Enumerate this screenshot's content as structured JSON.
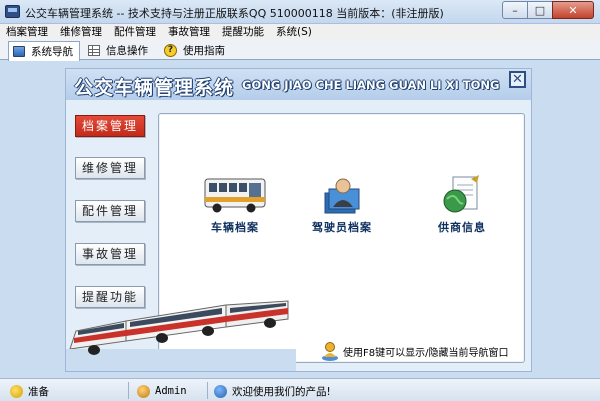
{
  "window": {
    "title": "公交车辆管理系统 -- 技术支持与注册正版联系QQ 510000118    当前版本：(非注册版)",
    "minimize": "–",
    "maximize": "□",
    "close": "✕"
  },
  "menu": [
    "档案管理",
    "维修管理",
    "配件管理",
    "事故管理",
    "提醒功能",
    "系统(S)"
  ],
  "tabs": [
    {
      "label": "系统导航",
      "icon": "monitor-icon",
      "active": true
    },
    {
      "label": "信息操作",
      "icon": "grid-icon",
      "active": false
    },
    {
      "label": "使用指南",
      "icon": "help-icon",
      "active": false
    }
  ],
  "banner": {
    "title": "公交车辆管理系统",
    "subtitle": "GONG JIAO CHE LIANG GUAN LI XI TONG",
    "close": "✕"
  },
  "sidebar": [
    {
      "label": "档案管理",
      "active": true
    },
    {
      "label": "维修管理",
      "active": false
    },
    {
      "label": "配件管理",
      "active": false
    },
    {
      "label": "事故管理",
      "active": false
    },
    {
      "label": "提醒功能",
      "active": false
    }
  ],
  "modules": [
    {
      "label": "车辆档案",
      "icon": "bus-icon"
    },
    {
      "label": "驾驶员档案",
      "icon": "driver-icon"
    },
    {
      "label": "供商信息",
      "icon": "globe-document-icon"
    }
  ],
  "hint": "使用F8键可以显示/隐藏当前导航窗口",
  "status": [
    {
      "text": "准备",
      "icon": "ready-icon"
    },
    {
      "text": "Admin",
      "icon": "user-icon"
    },
    {
      "text": "欢迎使用我们的产品!",
      "icon": "welcome-icon"
    }
  ],
  "colors": {
    "accent_red": "#d2311f",
    "banner_blue": "#1e3f73",
    "background": "#c9dcf0"
  }
}
